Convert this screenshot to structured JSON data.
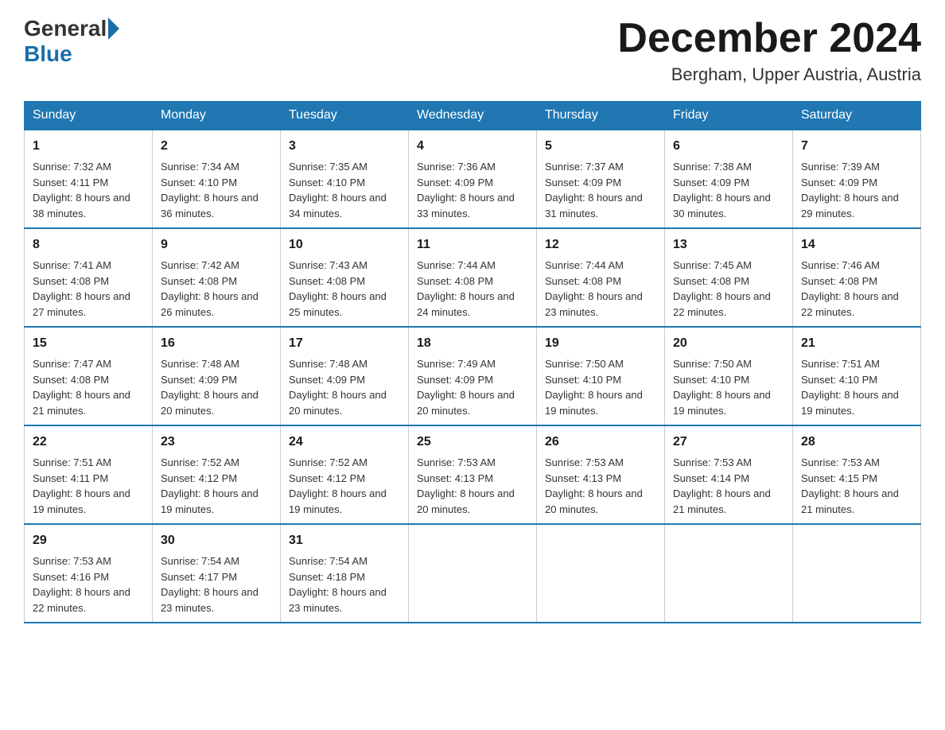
{
  "header": {
    "logo_text_general": "General",
    "logo_text_blue": "Blue",
    "month_year": "December 2024",
    "location": "Bergham, Upper Austria, Austria"
  },
  "days_of_week": [
    "Sunday",
    "Monday",
    "Tuesday",
    "Wednesday",
    "Thursday",
    "Friday",
    "Saturday"
  ],
  "weeks": [
    [
      {
        "day": "1",
        "sunrise": "7:32 AM",
        "sunset": "4:11 PM",
        "daylight": "8 hours and 38 minutes."
      },
      {
        "day": "2",
        "sunrise": "7:34 AM",
        "sunset": "4:10 PM",
        "daylight": "8 hours and 36 minutes."
      },
      {
        "day": "3",
        "sunrise": "7:35 AM",
        "sunset": "4:10 PM",
        "daylight": "8 hours and 34 minutes."
      },
      {
        "day": "4",
        "sunrise": "7:36 AM",
        "sunset": "4:09 PM",
        "daylight": "8 hours and 33 minutes."
      },
      {
        "day": "5",
        "sunrise": "7:37 AM",
        "sunset": "4:09 PM",
        "daylight": "8 hours and 31 minutes."
      },
      {
        "day": "6",
        "sunrise": "7:38 AM",
        "sunset": "4:09 PM",
        "daylight": "8 hours and 30 minutes."
      },
      {
        "day": "7",
        "sunrise": "7:39 AM",
        "sunset": "4:09 PM",
        "daylight": "8 hours and 29 minutes."
      }
    ],
    [
      {
        "day": "8",
        "sunrise": "7:41 AM",
        "sunset": "4:08 PM",
        "daylight": "8 hours and 27 minutes."
      },
      {
        "day": "9",
        "sunrise": "7:42 AM",
        "sunset": "4:08 PM",
        "daylight": "8 hours and 26 minutes."
      },
      {
        "day": "10",
        "sunrise": "7:43 AM",
        "sunset": "4:08 PM",
        "daylight": "8 hours and 25 minutes."
      },
      {
        "day": "11",
        "sunrise": "7:44 AM",
        "sunset": "4:08 PM",
        "daylight": "8 hours and 24 minutes."
      },
      {
        "day": "12",
        "sunrise": "7:44 AM",
        "sunset": "4:08 PM",
        "daylight": "8 hours and 23 minutes."
      },
      {
        "day": "13",
        "sunrise": "7:45 AM",
        "sunset": "4:08 PM",
        "daylight": "8 hours and 22 minutes."
      },
      {
        "day": "14",
        "sunrise": "7:46 AM",
        "sunset": "4:08 PM",
        "daylight": "8 hours and 22 minutes."
      }
    ],
    [
      {
        "day": "15",
        "sunrise": "7:47 AM",
        "sunset": "4:08 PM",
        "daylight": "8 hours and 21 minutes."
      },
      {
        "day": "16",
        "sunrise": "7:48 AM",
        "sunset": "4:09 PM",
        "daylight": "8 hours and 20 minutes."
      },
      {
        "day": "17",
        "sunrise": "7:48 AM",
        "sunset": "4:09 PM",
        "daylight": "8 hours and 20 minutes."
      },
      {
        "day": "18",
        "sunrise": "7:49 AM",
        "sunset": "4:09 PM",
        "daylight": "8 hours and 20 minutes."
      },
      {
        "day": "19",
        "sunrise": "7:50 AM",
        "sunset": "4:10 PM",
        "daylight": "8 hours and 19 minutes."
      },
      {
        "day": "20",
        "sunrise": "7:50 AM",
        "sunset": "4:10 PM",
        "daylight": "8 hours and 19 minutes."
      },
      {
        "day": "21",
        "sunrise": "7:51 AM",
        "sunset": "4:10 PM",
        "daylight": "8 hours and 19 minutes."
      }
    ],
    [
      {
        "day": "22",
        "sunrise": "7:51 AM",
        "sunset": "4:11 PM",
        "daylight": "8 hours and 19 minutes."
      },
      {
        "day": "23",
        "sunrise": "7:52 AM",
        "sunset": "4:12 PM",
        "daylight": "8 hours and 19 minutes."
      },
      {
        "day": "24",
        "sunrise": "7:52 AM",
        "sunset": "4:12 PM",
        "daylight": "8 hours and 19 minutes."
      },
      {
        "day": "25",
        "sunrise": "7:53 AM",
        "sunset": "4:13 PM",
        "daylight": "8 hours and 20 minutes."
      },
      {
        "day": "26",
        "sunrise": "7:53 AM",
        "sunset": "4:13 PM",
        "daylight": "8 hours and 20 minutes."
      },
      {
        "day": "27",
        "sunrise": "7:53 AM",
        "sunset": "4:14 PM",
        "daylight": "8 hours and 21 minutes."
      },
      {
        "day": "28",
        "sunrise": "7:53 AM",
        "sunset": "4:15 PM",
        "daylight": "8 hours and 21 minutes."
      }
    ],
    [
      {
        "day": "29",
        "sunrise": "7:53 AM",
        "sunset": "4:16 PM",
        "daylight": "8 hours and 22 minutes."
      },
      {
        "day": "30",
        "sunrise": "7:54 AM",
        "sunset": "4:17 PM",
        "daylight": "8 hours and 23 minutes."
      },
      {
        "day": "31",
        "sunrise": "7:54 AM",
        "sunset": "4:18 PM",
        "daylight": "8 hours and 23 minutes."
      },
      null,
      null,
      null,
      null
    ]
  ],
  "labels": {
    "sunrise": "Sunrise:",
    "sunset": "Sunset:",
    "daylight": "Daylight:"
  }
}
